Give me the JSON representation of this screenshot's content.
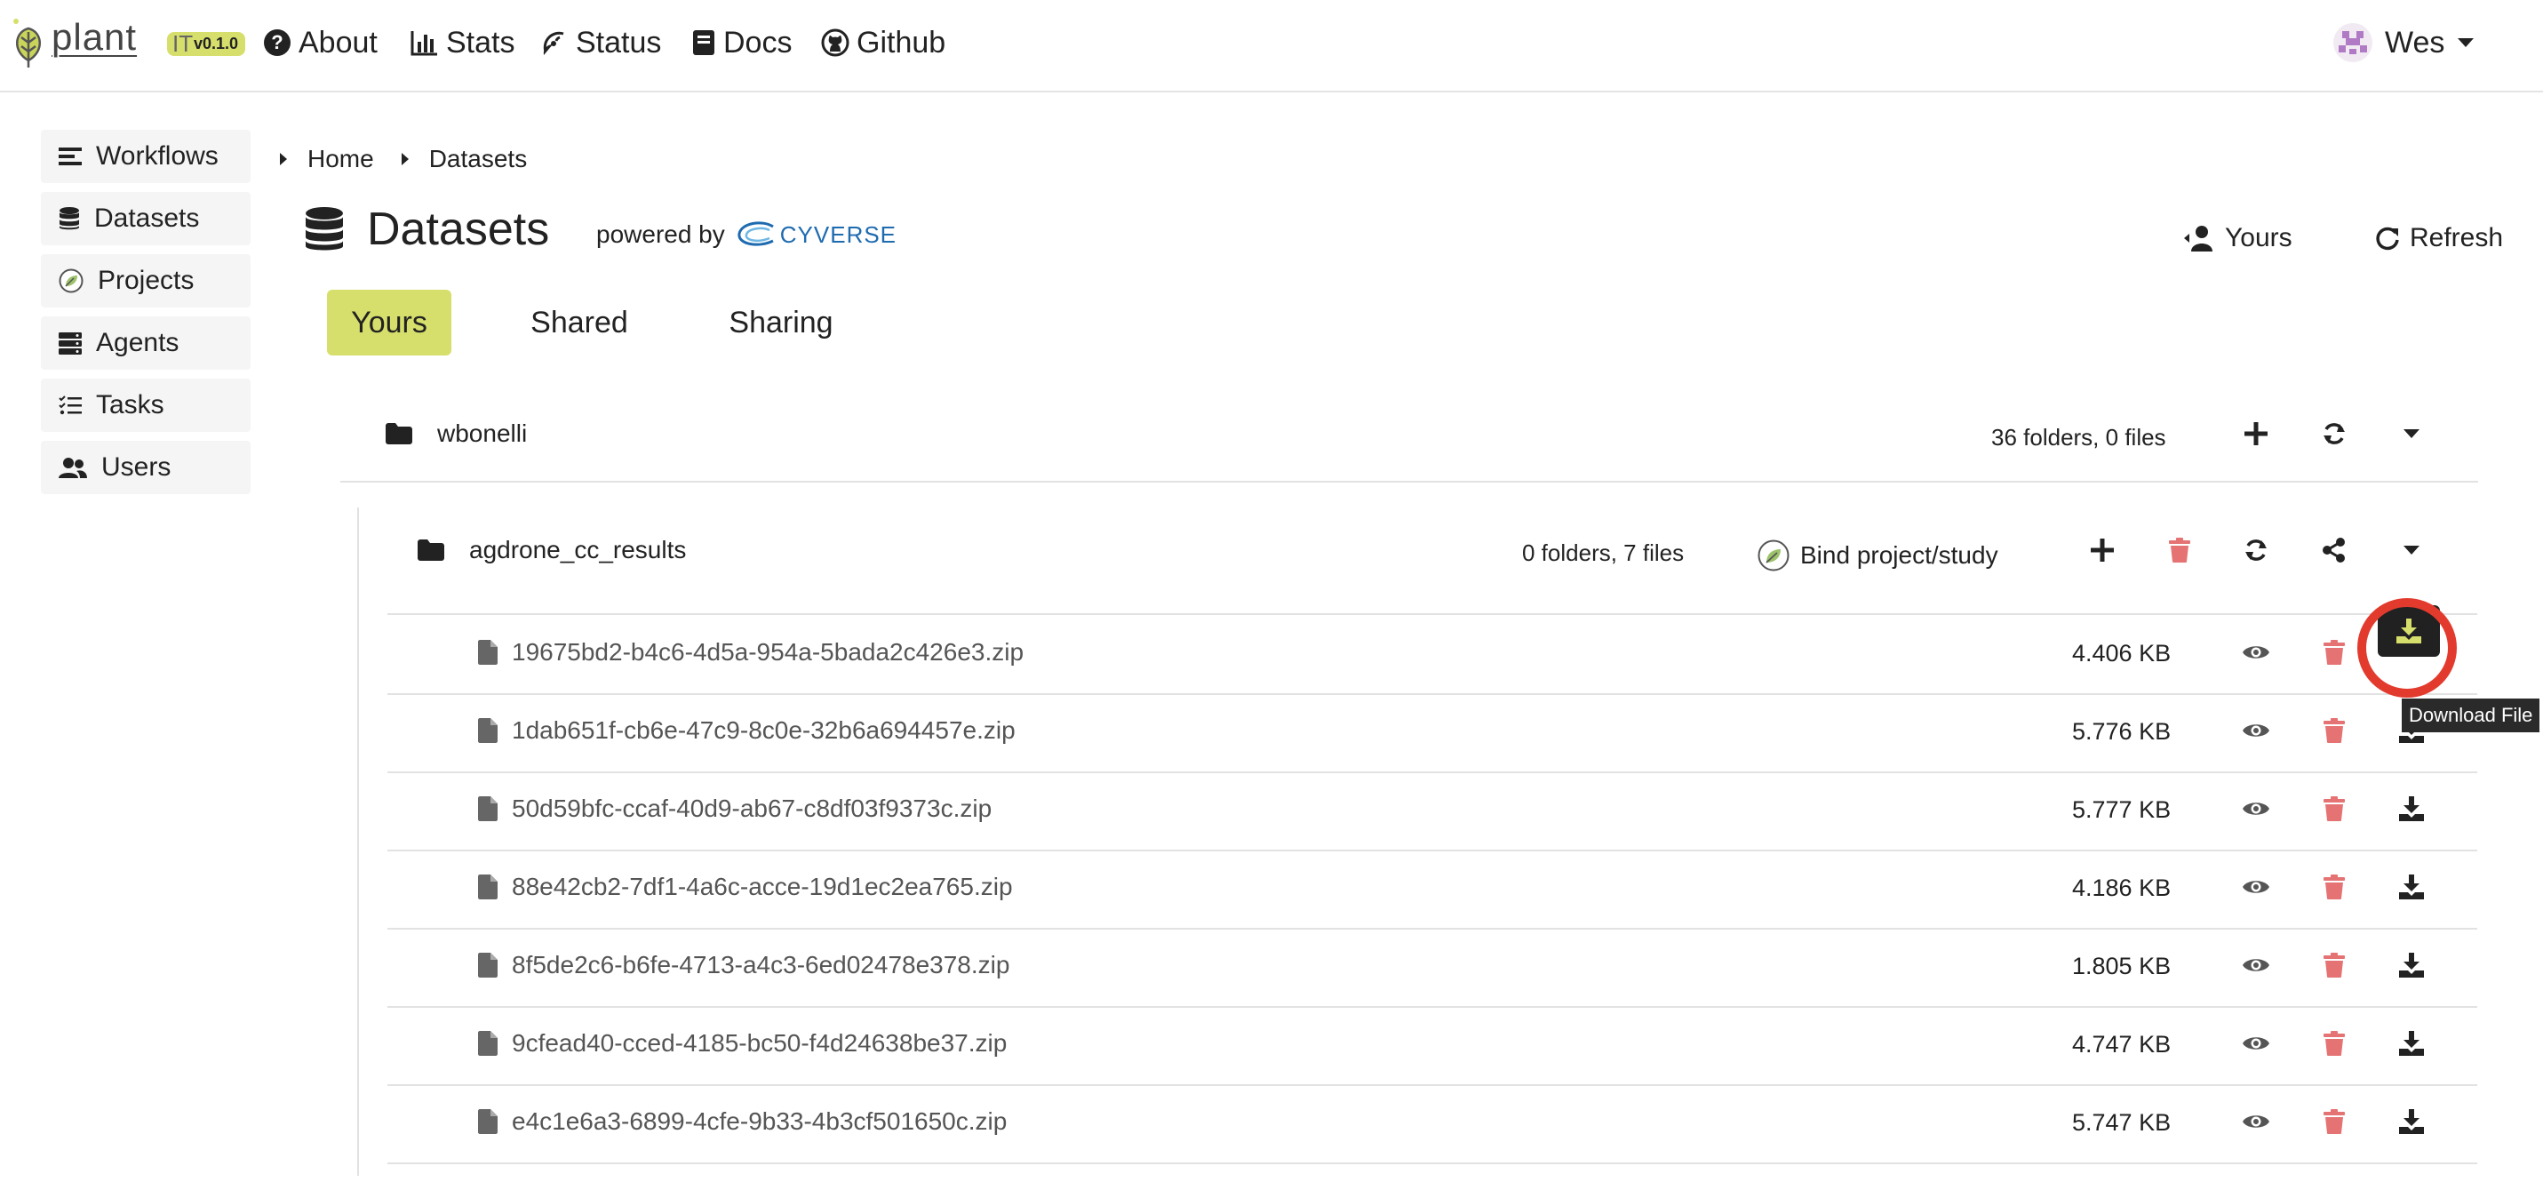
{
  "app": {
    "logo_text": "plant",
    "logo_mark": "IT",
    "version": "v0.1.0"
  },
  "nav": {
    "about": "About",
    "stats": "Stats",
    "status": "Status",
    "docs": "Docs",
    "github": "Github",
    "user": "Wes"
  },
  "sidebar": {
    "items": [
      {
        "label": "Workflows",
        "icon": "list-icon"
      },
      {
        "label": "Datasets",
        "icon": "database-icon"
      },
      {
        "label": "Projects",
        "icon": "leaf-icon"
      },
      {
        "label": "Agents",
        "icon": "server-icon"
      },
      {
        "label": "Tasks",
        "icon": "tasks-icon"
      },
      {
        "label": "Users",
        "icon": "users-icon"
      }
    ]
  },
  "breadcrumb": [
    "Home",
    "Datasets"
  ],
  "header": {
    "title": "Datasets",
    "powered_by": "powered by",
    "brand": "CYVERSE",
    "yours_button": "Yours",
    "refresh_button": "Refresh"
  },
  "tabs": [
    {
      "label": "Yours",
      "active": true
    },
    {
      "label": "Shared",
      "active": false
    },
    {
      "label": "Sharing",
      "active": false
    }
  ],
  "root_folder": {
    "name": "wbonelli",
    "summary": "36 folders, 0 files"
  },
  "subfolder": {
    "name": "agdrone_cc_results",
    "summary": "0 folders, 7 files",
    "bind_label": "Bind project/study"
  },
  "files": [
    {
      "name": "19675bd2-b4c6-4d5a-954a-5bada2c426e3.zip",
      "size": "4.406 KB"
    },
    {
      "name": "1dab651f-cb6e-47c9-8c0e-32b6a694457e.zip",
      "size": "5.776 KB"
    },
    {
      "name": "50d59bfc-ccaf-40d9-ab67-c8df03f9373c.zip",
      "size": "5.777 KB"
    },
    {
      "name": "88e42cb2-7df1-4a6c-acce-19d1ec2ea765.zip",
      "size": "4.186 KB"
    },
    {
      "name": "8f5de2c6-b6fe-4713-a4c3-6ed02478e378.zip",
      "size": "1.805 KB"
    },
    {
      "name": "9cfead40-cced-4185-bc50-f4d24638be37.zip",
      "size": "4.747 KB"
    },
    {
      "name": "e4c1e6a3-6899-4cfe-9b33-4b3cf501650c.zip",
      "size": "5.747 KB"
    }
  ],
  "tooltip": "Download File",
  "colors": {
    "accent": "#d6df6b",
    "delete": "#e57373",
    "highlight_ring": "#e23b2e",
    "cyverse": "#1e6bb0"
  }
}
